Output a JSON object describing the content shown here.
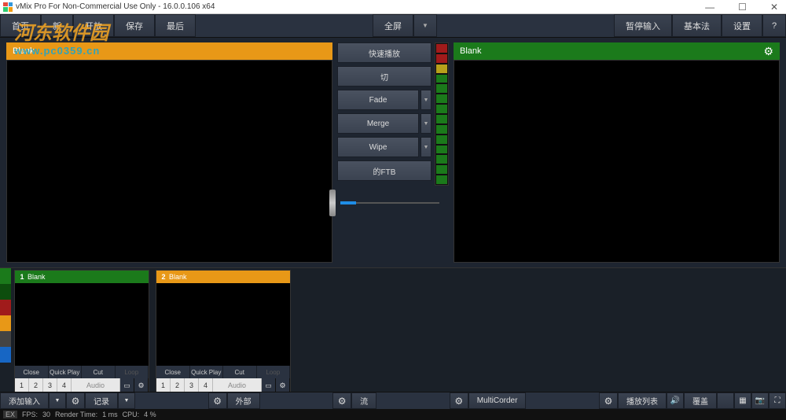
{
  "window": {
    "title": "vMix Pro For Non-Commercial Use Only - 16.0.0.106 x64",
    "minimize": "—",
    "maximize": "☐",
    "close": "✕"
  },
  "watermark": {
    "brand": "河东软件园",
    "url": "www.pc0359.cn"
  },
  "topbar": {
    "home": "首页",
    "new": "新",
    "open": "开放",
    "save": "保存",
    "last": "最后",
    "fullscreen": "全屏",
    "pause_input": "暂停输入",
    "basic": "基本法",
    "settings": "设置",
    "help": "?"
  },
  "preview": {
    "label": "Blank"
  },
  "output": {
    "label": "Blank"
  },
  "transitions": {
    "quickplay": "快速播放",
    "cut": "切",
    "fade": "Fade",
    "merge": "Merge",
    "wipe": "Wipe",
    "ftb": "的FTB"
  },
  "inputs": [
    {
      "num": "1",
      "label": "Blank"
    },
    {
      "num": "2",
      "label": "Blank"
    }
  ],
  "input_controls": {
    "close": "Close",
    "quickplay": "Quick Play",
    "cut": "Cut",
    "loop": "Loop",
    "n1": "1",
    "n2": "2",
    "n3": "3",
    "n4": "4",
    "audio": "Audio"
  },
  "bottombar": {
    "add_input": "添加输入",
    "record": "记录",
    "external": "外部",
    "stream": "流",
    "multicorder": "MultiCorder",
    "playlist": "播放列表",
    "overlay": "覆盖"
  },
  "statusbar": {
    "ex": "EX",
    "fps_label": "FPS:",
    "fps": "30",
    "render_label": "Render Time:",
    "render": "1 ms",
    "cpu_label": "CPU:",
    "cpu": "4 %"
  }
}
